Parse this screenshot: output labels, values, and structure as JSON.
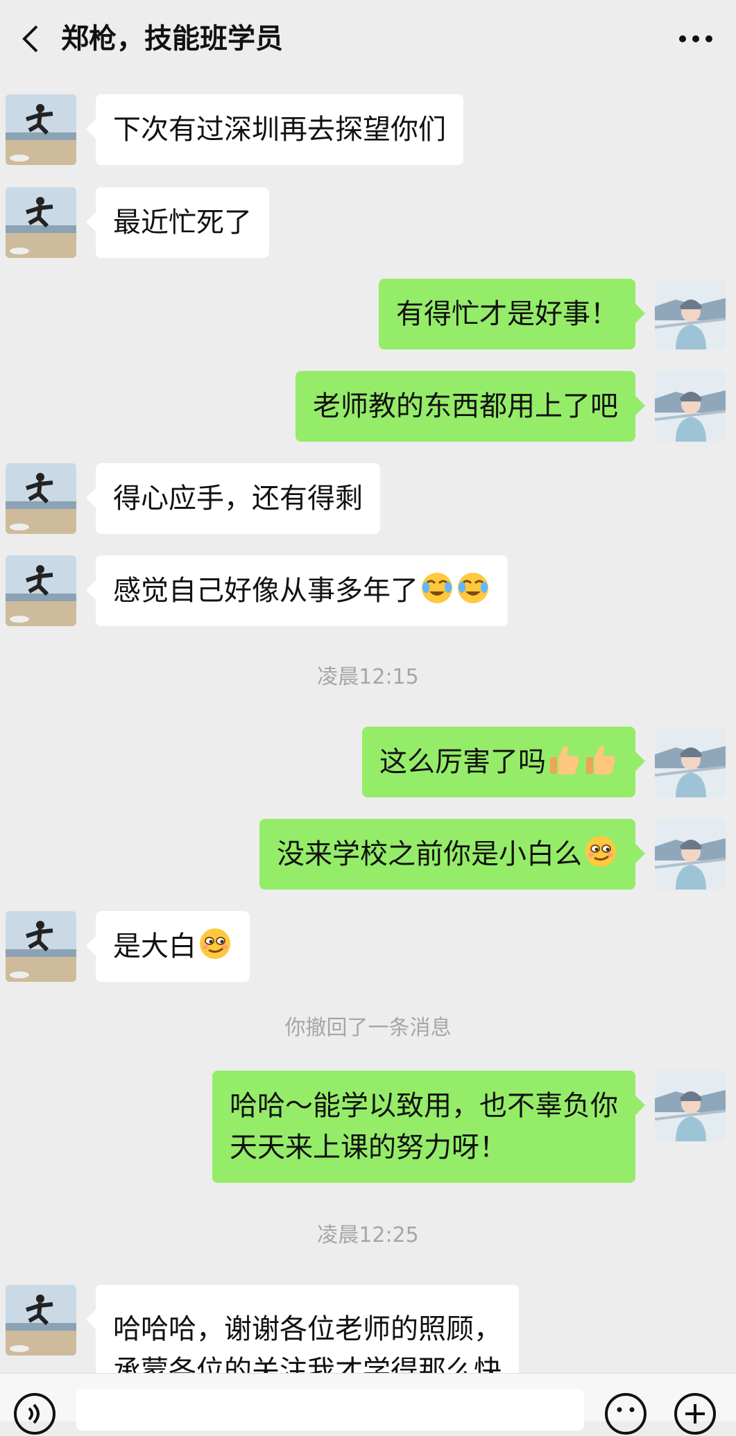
{
  "header": {
    "title": "郑枪，技能班学员",
    "back_icon": "chevron-left-icon",
    "more_icon": "more-horizontal-icon"
  },
  "messages": [
    {
      "side": "in",
      "text": "下次有过深圳再去探望你们"
    },
    {
      "side": "in",
      "text": "最近忙死了"
    },
    {
      "side": "out",
      "text": "有得忙才是好事！"
    },
    {
      "side": "out",
      "text": "老师教的东西都用上了吧"
    },
    {
      "side": "in",
      "text": "得心应手，还有得剩"
    },
    {
      "side": "in",
      "text": "感觉自己好像从事多年了",
      "emoji": [
        "facepalm-laugh-emoji",
        "facepalm-laugh-emoji"
      ]
    },
    {
      "type": "time",
      "text": "凌晨12:15"
    },
    {
      "side": "out",
      "text": "这么厉害了吗",
      "emoji": [
        "thumbs-up-emoji",
        "thumbs-up-emoji"
      ]
    },
    {
      "side": "out",
      "text": "没来学校之前你是小白么",
      "emoji": [
        "smirk-emoji"
      ]
    },
    {
      "side": "in",
      "text": "是大白",
      "emoji": [
        "smirk-emoji"
      ]
    },
    {
      "type": "system",
      "text": "你撤回了一条消息"
    },
    {
      "side": "out",
      "lines": [
        "哈哈～能学以致用，也不辜负你",
        "天天来上课的努力呀！"
      ]
    },
    {
      "type": "time",
      "text": "凌晨12:25"
    },
    {
      "side": "in",
      "lines": [
        "哈哈哈，谢谢各位老师的照顾，",
        "承蒙各位的关注我才学得那么快"
      ]
    }
  ],
  "input_bar": {
    "voice_icon": "voice-icon",
    "emoji_icon": "emoji-smile-icon",
    "add_icon": "plus-circle-icon"
  },
  "colors": {
    "background": "#ededed",
    "outgoing_bubble": "#95ec69",
    "incoming_bubble": "#ffffff",
    "system_text": "#a6a6a6"
  }
}
